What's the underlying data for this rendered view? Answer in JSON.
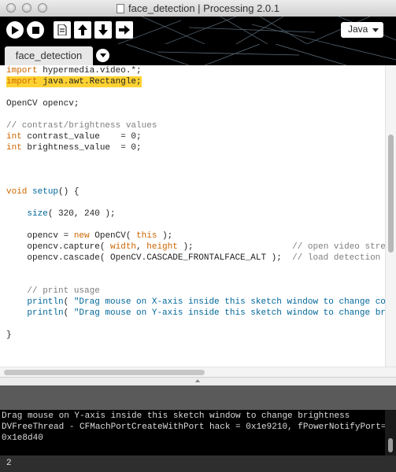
{
  "window": {
    "title": "face_detection | Processing 2.0.1"
  },
  "toolbar": {
    "buttons": [
      {
        "name": "run-button",
        "icon": "play-icon"
      },
      {
        "name": "stop-button",
        "icon": "stop-icon"
      },
      {
        "name": "new-button",
        "icon": "new-document-icon"
      },
      {
        "name": "open-button",
        "icon": "arrow-up-icon"
      },
      {
        "name": "save-button",
        "icon": "arrow-down-icon"
      },
      {
        "name": "export-button",
        "icon": "export-arrow-icon"
      }
    ],
    "mode": "Java"
  },
  "tabs": {
    "items": [
      {
        "label": "face_detection"
      }
    ]
  },
  "editor": {
    "colors": {
      "keyword": "#cc6600",
      "comment": "#7e7e7e",
      "function": "#006699",
      "highlight": "#ffd232"
    },
    "lines": [
      "import hypermedia.video.*;",
      "import java.awt.Rectangle;",
      "",
      "OpenCV opencv;",
      "",
      "// contrast/brightness values",
      "int contrast_value    = 0;",
      "int brightness_value  = 0;",
      "",
      "",
      "",
      "void setup() {",
      "",
      "    size( 320, 240 );",
      "",
      "    opencv = new OpenCV( this );",
      "    opencv.capture( width, height );                   // open video stream",
      "    opencv.cascade( OpenCV.CASCADE_FRONTALFACE_ALT );  // load detection descrip",
      "",
      "",
      "    // print usage",
      "    println( \"Drag mouse on X-axis inside this sketch window to change contrast\"",
      "    println( \"Drag mouse on Y-axis inside this sketch window to change brightnes",
      "",
      "}"
    ]
  },
  "console": {
    "lines": [
      "Drag mouse on Y-axis inside this sketch window to change brightness",
      "DVFreeThread - CFMachPortCreateWithPort hack = 0x1e9210, fPowerNotifyPort=",
      "0x1e8d40"
    ]
  },
  "status": {
    "line_number": "2"
  }
}
